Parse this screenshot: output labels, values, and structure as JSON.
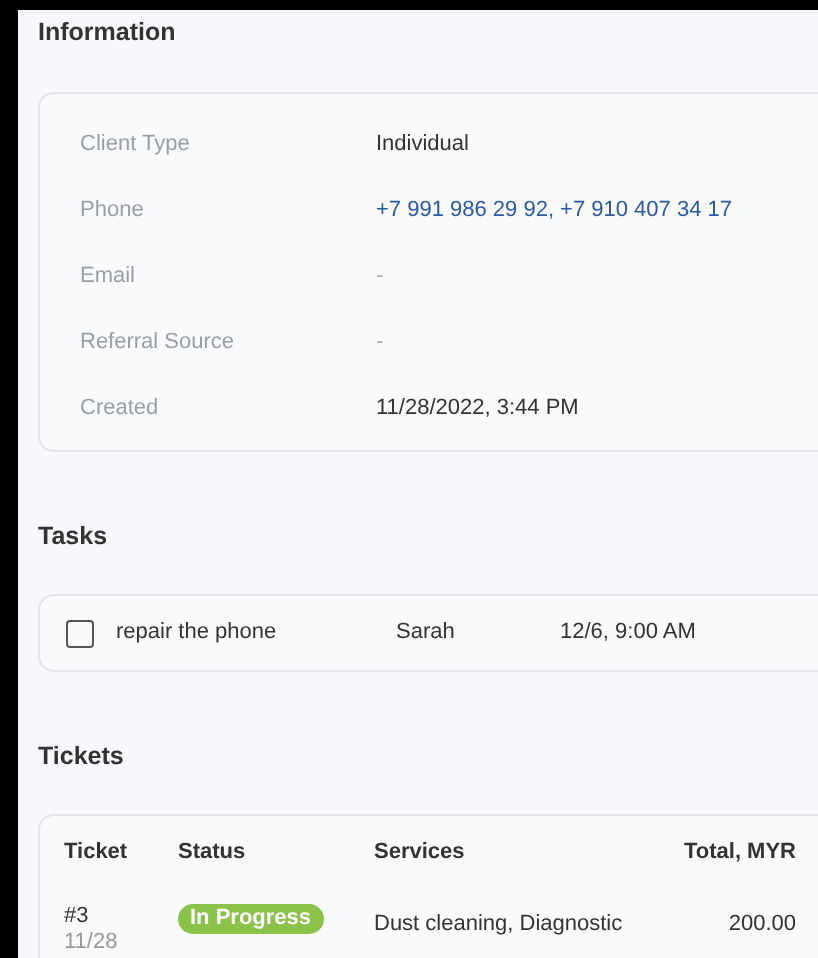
{
  "information": {
    "title": "Information",
    "fields": [
      {
        "label": "Client Type",
        "value": "Individual",
        "kind": "text"
      },
      {
        "label": "Phone",
        "value": "+7 991 986 29 92, +7 910 407 34 17",
        "kind": "link"
      },
      {
        "label": "Email",
        "value": "-",
        "kind": "empty"
      },
      {
        "label": "Referral Source",
        "value": "-",
        "kind": "empty"
      },
      {
        "label": "Created",
        "value": "11/28/2022, 3:44 PM",
        "kind": "text"
      }
    ]
  },
  "tasks": {
    "title": "Tasks",
    "items": [
      {
        "title": "repair the phone",
        "assignee": "Sarah",
        "due": "12/6, 9:00 AM",
        "checked": false
      }
    ]
  },
  "tickets": {
    "title": "Tickets",
    "columns": [
      "Ticket",
      "Status",
      "Services",
      "Total, MYR"
    ],
    "rows": [
      {
        "number": "#3",
        "date": "11/28",
        "status": "In Progress",
        "color": "#8bc34a",
        "services": "Dust cleaning, Diagnostic",
        "total": "200.00"
      }
    ]
  }
}
